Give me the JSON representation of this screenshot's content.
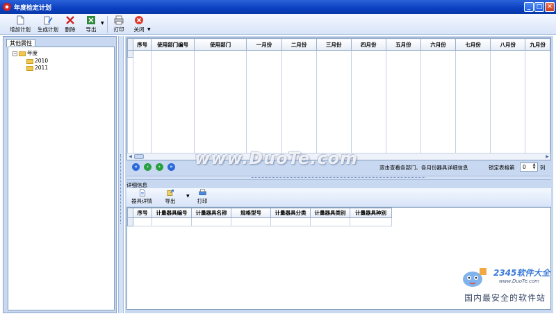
{
  "window": {
    "title": "年度检定计划",
    "minimize": "_",
    "maximize": "□",
    "close": "✕"
  },
  "toolbar": {
    "add_plan": "增加计划",
    "generate_plan": "生成计划",
    "delete": "删除",
    "export": "导出",
    "print": "打印",
    "close": "关闭"
  },
  "left_panel": {
    "tab": "其他属性",
    "tree": {
      "root": "年度",
      "children": [
        "2010",
        "2011"
      ]
    }
  },
  "plan_grid": {
    "columns": [
      "序号",
      "使用部门编号",
      "使用部门",
      "一月份",
      "二月份",
      "三月份",
      "四月份",
      "五月份",
      "六月份",
      "七月份",
      "八月份",
      "九月份"
    ]
  },
  "navbar": {
    "hint": "双击查看各部门、各月份器具详细信息",
    "lock_label": "锁定表格第",
    "lock_value": "0",
    "lock_unit": "列"
  },
  "detail": {
    "title": "详细信息",
    "toolbar": {
      "detail": "器具详情",
      "export": "导出",
      "print": "打印"
    },
    "columns": [
      "序号",
      "计量器具编号",
      "计量器具名称",
      "规格型号",
      "计量器具分类",
      "计量器具类别",
      "计量器具种别"
    ]
  },
  "watermarks": {
    "duote": "www.DuoTe.com",
    "brand": "2345软件大全",
    "url": "www.DuoTe.com",
    "slogan": "国内最安全的软件站"
  },
  "colors": {
    "titlebar": "#0a3fc0",
    "panel_bg": "#c8d8f0",
    "grid_border": "#7f9db9"
  }
}
